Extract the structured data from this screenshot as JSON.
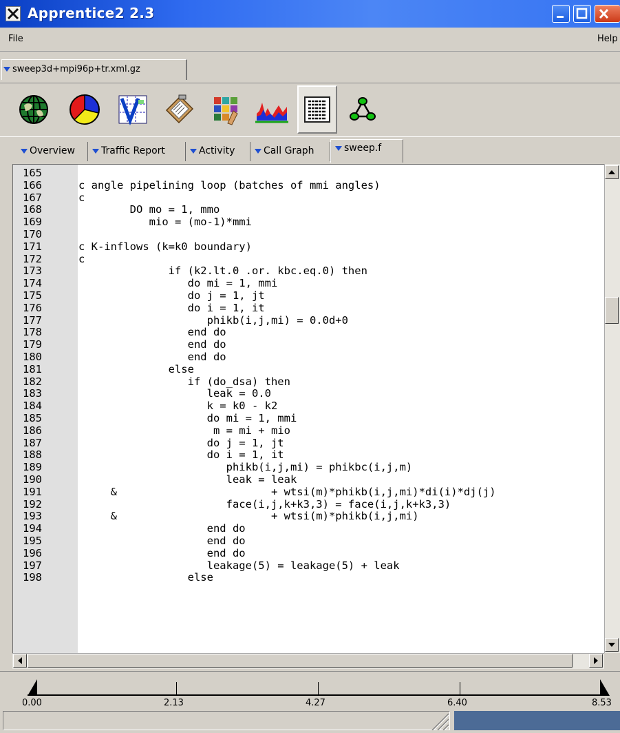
{
  "window": {
    "title": "Apprentice2 2.3"
  },
  "menu": {
    "file": "File",
    "help": "Help"
  },
  "file_tab": {
    "label": "sweep3d+mpi96p+tr.xml.gz"
  },
  "toolbar": {
    "icons": [
      "globe-icon",
      "pie-chart-icon",
      "v-grid-icon",
      "clipboard-icon",
      "palette-icon",
      "histogram-icon",
      "text-list-icon",
      "tree-icon"
    ],
    "active": "text-list-icon"
  },
  "tabs": [
    {
      "label": "Overview",
      "selected": false
    },
    {
      "label": "Traffic Report",
      "selected": false
    },
    {
      "label": "Activity",
      "selected": false
    },
    {
      "label": "Call Graph",
      "selected": false
    },
    {
      "label": "sweep.f",
      "selected": true
    }
  ],
  "code_lines": [
    {
      "n": "165",
      "code": ""
    },
    {
      "n": "166",
      "code": "c angle pipelining loop (batches of mmi angles)"
    },
    {
      "n": "167",
      "code": "c"
    },
    {
      "n": "168",
      "code": "        DO mo = 1, mmo"
    },
    {
      "n": "169",
      "code": "           mio = (mo-1)*mmi"
    },
    {
      "n": "170",
      "code": ""
    },
    {
      "n": "171",
      "code": "c K-inflows (k=k0 boundary)"
    },
    {
      "n": "172",
      "code": "c"
    },
    {
      "n": "173",
      "code": "              if (k2.lt.0 .or. kbc.eq.0) then"
    },
    {
      "n": "174",
      "code": "                 do mi = 1, mmi"
    },
    {
      "n": "175",
      "code": "                 do j = 1, jt"
    },
    {
      "n": "176",
      "code": "                 do i = 1, it"
    },
    {
      "n": "177",
      "code": "                    phikb(i,j,mi) = 0.0d+0"
    },
    {
      "n": "178",
      "code": "                 end do"
    },
    {
      "n": "179",
      "code": "                 end do"
    },
    {
      "n": "180",
      "code": "                 end do"
    },
    {
      "n": "181",
      "code": "              else"
    },
    {
      "n": "182",
      "code": "                 if (do_dsa) then"
    },
    {
      "n": "183",
      "code": "                    leak = 0.0"
    },
    {
      "n": "184",
      "code": "                    k = k0 - k2"
    },
    {
      "n": "185",
      "code": "                    do mi = 1, mmi"
    },
    {
      "n": "186",
      "code": "                     m = mi + mio"
    },
    {
      "n": "187",
      "code": "                    do j = 1, jt"
    },
    {
      "n": "188",
      "code": "                    do i = 1, it"
    },
    {
      "n": "189",
      "code": "                       phikb(i,j,mi) = phikbc(i,j,m)"
    },
    {
      "n": "190",
      "code": "                       leak = leak"
    },
    {
      "n": "191",
      "code": "     &                        + wtsi(m)*phikb(i,j,mi)*di(i)*dj(j)"
    },
    {
      "n": "192",
      "code": "                       face(i,j,k+k3,3) = face(i,j,k+k3,3)"
    },
    {
      "n": "193",
      "code": "     &                        + wtsi(m)*phikb(i,j,mi)"
    },
    {
      "n": "194",
      "code": "                    end do"
    },
    {
      "n": "195",
      "code": "                    end do"
    },
    {
      "n": "196",
      "code": "                    end do"
    },
    {
      "n": "197",
      "code": "                    leakage(5) = leakage(5) + leak"
    },
    {
      "n": "198",
      "code": "                 else"
    }
  ],
  "timeline": {
    "labels": [
      "0.00",
      "2.13",
      "4.27",
      "6.40",
      "8.53"
    ]
  }
}
